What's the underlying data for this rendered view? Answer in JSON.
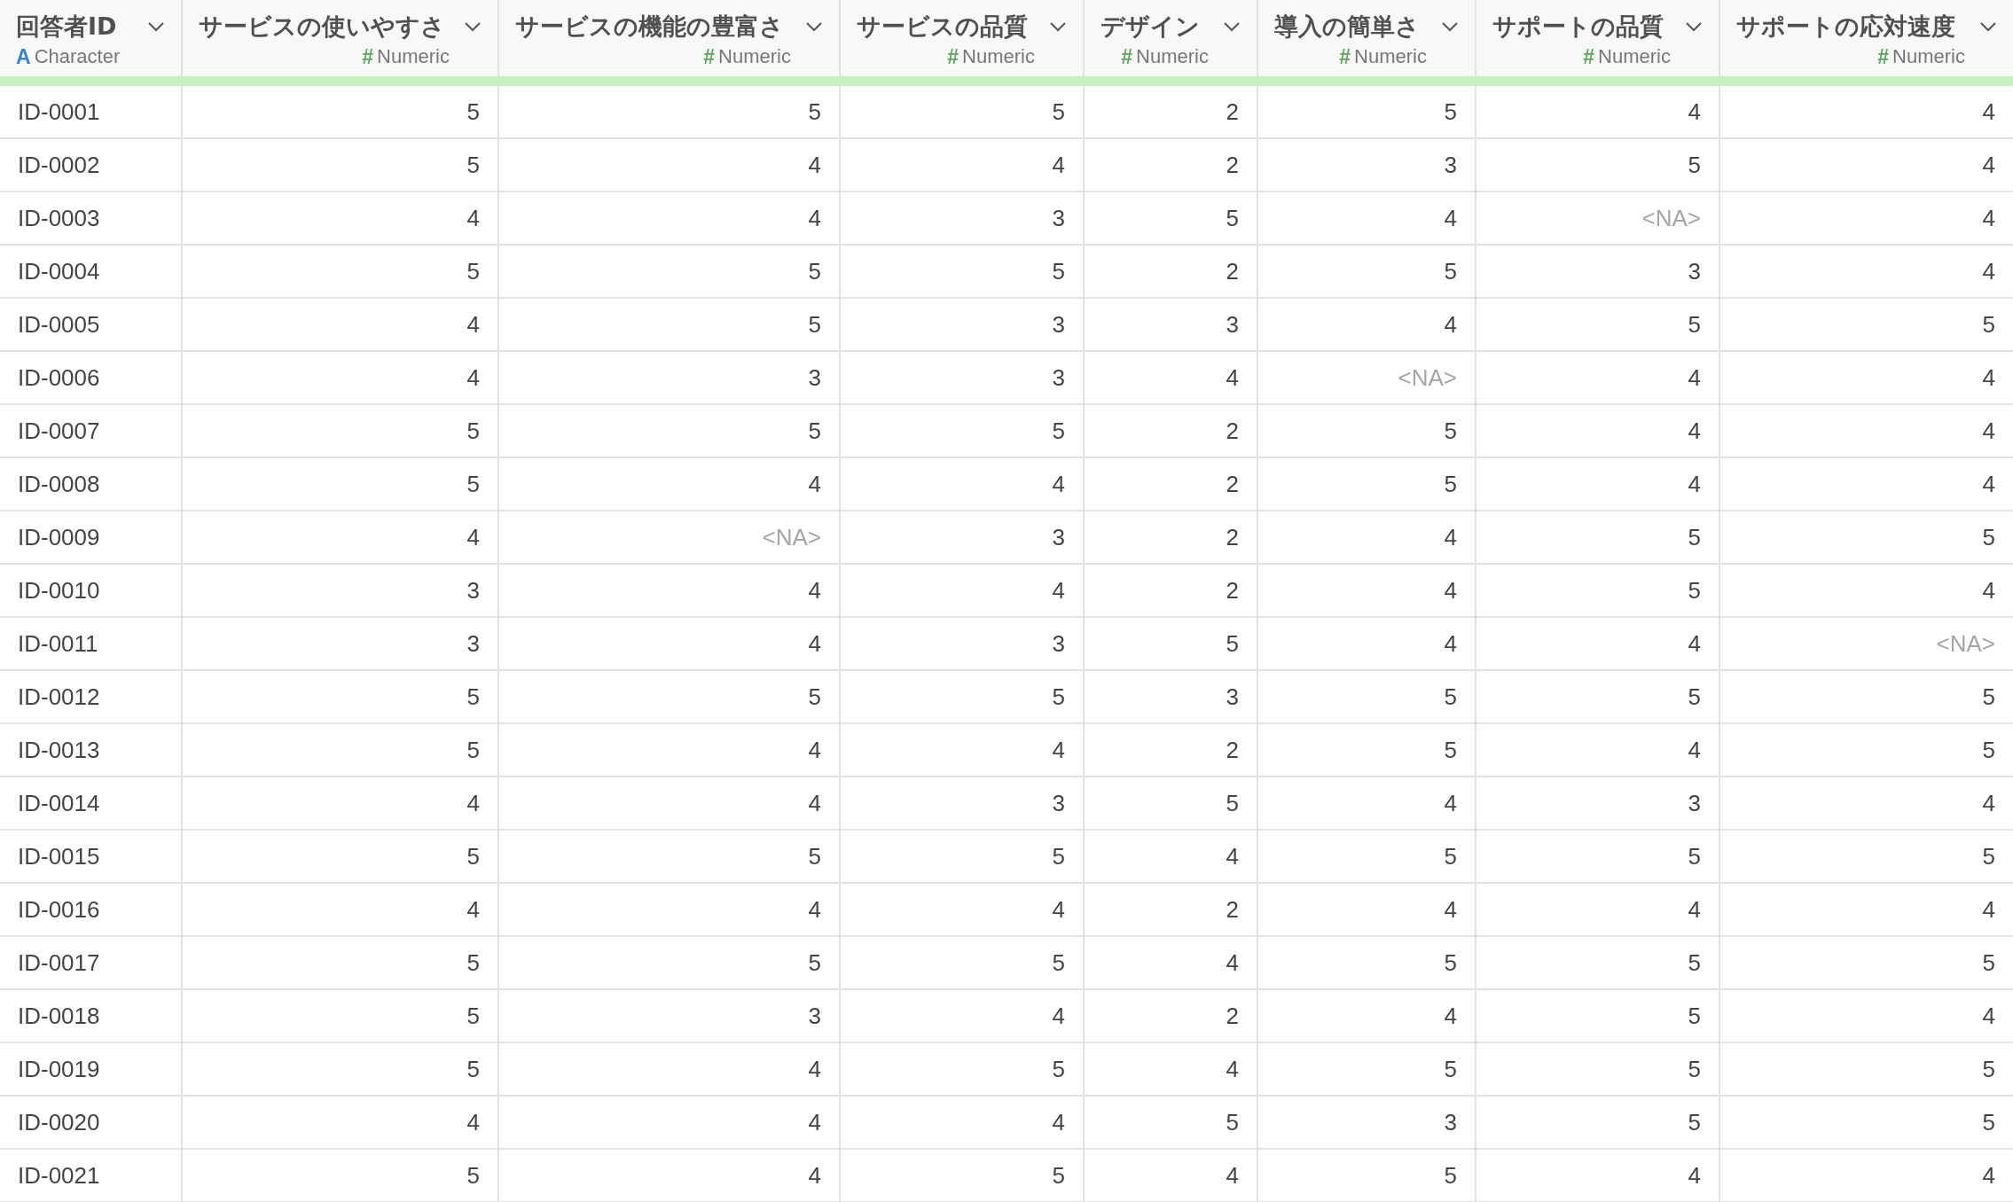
{
  "table": {
    "columns": [
      {
        "title": "回答者ID",
        "kind": "character",
        "type_icon": "A",
        "type": "Character"
      },
      {
        "title": "サービスの使いやすさ",
        "kind": "numeric",
        "type_icon": "#",
        "type": "Numeric"
      },
      {
        "title": "サービスの機能の豊富さ",
        "kind": "numeric",
        "type_icon": "#",
        "type": "Numeric"
      },
      {
        "title": "サービスの品質",
        "kind": "numeric",
        "type_icon": "#",
        "type": "Numeric"
      },
      {
        "title": "デザイン",
        "kind": "numeric",
        "type_icon": "#",
        "type": "Numeric"
      },
      {
        "title": "導入の簡単さ",
        "kind": "numeric",
        "type_icon": "#",
        "type": "Numeric"
      },
      {
        "title": "サポートの品質",
        "kind": "numeric",
        "type_icon": "#",
        "type": "Numeric"
      },
      {
        "title": "サポートの応対速度",
        "kind": "numeric",
        "type_icon": "#",
        "type": "Numeric"
      }
    ],
    "rows": [
      [
        "ID-0001",
        "5",
        "5",
        "5",
        "2",
        "5",
        "4",
        "4"
      ],
      [
        "ID-0002",
        "5",
        "4",
        "4",
        "2",
        "3",
        "5",
        "4"
      ],
      [
        "ID-0003",
        "4",
        "4",
        "3",
        "5",
        "4",
        {
          "text": "<NA>",
          "missing": true
        },
        "4"
      ],
      [
        "ID-0004",
        "5",
        "5",
        "5",
        "2",
        "5",
        "3",
        "4"
      ],
      [
        "ID-0005",
        "4",
        "5",
        "3",
        "3",
        "4",
        "5",
        "5"
      ],
      [
        "ID-0006",
        "4",
        "3",
        "3",
        "4",
        {
          "text": "<NA>",
          "missing": true
        },
        "4",
        "4"
      ],
      [
        "ID-0007",
        "5",
        "5",
        "5",
        "2",
        "5",
        "4",
        "4"
      ],
      [
        "ID-0008",
        "5",
        "4",
        "4",
        "2",
        "5",
        "4",
        "4"
      ],
      [
        "ID-0009",
        "4",
        {
          "text": "<NA>",
          "missing": true
        },
        "3",
        "2",
        "4",
        "5",
        "5"
      ],
      [
        "ID-0010",
        "3",
        "4",
        "4",
        "2",
        "4",
        "5",
        "4"
      ],
      [
        "ID-0011",
        "3",
        "4",
        "3",
        "5",
        "4",
        "4",
        {
          "text": "<NA>",
          "missing": true
        }
      ],
      [
        "ID-0012",
        "5",
        "5",
        "5",
        "3",
        "5",
        "5",
        "5"
      ],
      [
        "ID-0013",
        "5",
        "4",
        "4",
        "2",
        "5",
        "4",
        "5"
      ],
      [
        "ID-0014",
        "4",
        "4",
        "3",
        "5",
        "4",
        "3",
        "4"
      ],
      [
        "ID-0015",
        "5",
        "5",
        "5",
        "4",
        "5",
        "5",
        "5"
      ],
      [
        "ID-0016",
        "4",
        "4",
        "4",
        "2",
        "4",
        "4",
        "4"
      ],
      [
        "ID-0017",
        "5",
        "5",
        "5",
        "4",
        "5",
        "5",
        "5"
      ],
      [
        "ID-0018",
        "5",
        "3",
        "4",
        "2",
        "4",
        "5",
        "4"
      ],
      [
        "ID-0019",
        "5",
        "4",
        "5",
        "4",
        "5",
        "5",
        "5"
      ],
      [
        "ID-0020",
        "4",
        "4",
        "4",
        "5",
        "3",
        "5",
        "5"
      ],
      [
        "ID-0021",
        "5",
        "4",
        "5",
        "4",
        "5",
        "4",
        "4"
      ]
    ]
  }
}
